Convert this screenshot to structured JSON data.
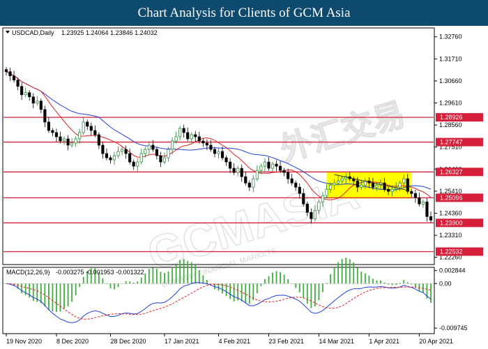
{
  "page_title": "Chart Analysis for Clients of GCM Asia",
  "watermark": {
    "main": "GCMASIA",
    "brand": "外汇交易",
    "sub": "GCMASIA FINANCIAL MARKETS"
  },
  "chart_data": {
    "type": "candlestick",
    "symbol_header": "USDCAD,Daily",
    "ohlc_header": "1.23925 1.24064 1.23846 1.24032",
    "ylim": [
      1.2195,
      1.3315
    ],
    "y_ticks": [
      "1.32760",
      "1.31710",
      "1.30660",
      "1.29610",
      "1.28560",
      "1.27510",
      "1.26460",
      "1.25410",
      "1.24360",
      "1.23310",
      "1.22260"
    ],
    "x_tick_labels": [
      {
        "label": "19 Nov 2020",
        "index": 0
      },
      {
        "label": "8 Dec 2020",
        "index": 13
      },
      {
        "label": "28 Dec 2020",
        "index": 27
      },
      {
        "label": "17 Jan 2021",
        "index": 41
      },
      {
        "label": "4 Feb 2021",
        "index": 55
      },
      {
        "label": "23 Feb 2021",
        "index": 68
      },
      {
        "label": "14 Mar 2021",
        "index": 81
      },
      {
        "label": "1 Apr 2021",
        "index": 94
      },
      {
        "label": "20 Apr 2021",
        "index": 107
      }
    ],
    "levels": [
      {
        "label": "1.28926",
        "value": 1.28926
      },
      {
        "label": "1.27747",
        "value": 1.27747
      },
      {
        "label": "1.26327",
        "value": 1.26327
      },
      {
        "label": "1.25096",
        "value": 1.25096
      },
      {
        "label": "1.23900",
        "value": 1.239
      },
      {
        "label": "1.22532",
        "value": 1.22532
      }
    ],
    "consolidation_box": {
      "start_index": 83,
      "end_index": 105,
      "low": 1.2506,
      "high": 1.2632
    },
    "trend_segment": {
      "start_index": 85,
      "end_index": 104,
      "start_value": 1.262,
      "end_value": 1.2545
    },
    "close": [
      1.311,
      1.309,
      1.307,
      1.304,
      1.3,
      1.301,
      1.299,
      1.296,
      1.297,
      1.293,
      1.287,
      1.283,
      1.282,
      1.28,
      1.278,
      1.279,
      1.276,
      1.277,
      1.279,
      1.282,
      1.287,
      1.285,
      1.283,
      1.281,
      1.276,
      1.272,
      1.27,
      1.269,
      1.271,
      1.273,
      1.274,
      1.272,
      1.268,
      1.266,
      1.268,
      1.272,
      1.274,
      1.276,
      1.274,
      1.271,
      1.268,
      1.27,
      1.274,
      1.278,
      1.28,
      1.284,
      1.282,
      1.279,
      1.281,
      1.28,
      1.278,
      1.277,
      1.276,
      1.274,
      1.272,
      1.273,
      1.27,
      1.268,
      1.265,
      1.263,
      1.265,
      1.261,
      1.258,
      1.256,
      1.26,
      1.264,
      1.266,
      1.268,
      1.265,
      1.267,
      1.266,
      1.264,
      1.263,
      1.26,
      1.258,
      1.256,
      1.253,
      1.248,
      1.244,
      1.241,
      1.245,
      1.249,
      1.252,
      1.255,
      1.257,
      1.258,
      1.259,
      1.26,
      1.261,
      1.26,
      1.259,
      1.256,
      1.257,
      1.259,
      1.258,
      1.256,
      1.257,
      1.258,
      1.255,
      1.254,
      1.255,
      1.256,
      1.258,
      1.26,
      1.254,
      1.253,
      1.251,
      1.248,
      1.249,
      1.242,
      1.2403
    ],
    "indicator": {
      "title": "MACD(12,26,9)",
      "values_header": "-0.003275 -0.001953 -0.001322",
      "ylim": [
        -0.0108,
        0.0034
      ],
      "y_tick_labels": [
        {
          "label": "0.002844",
          "value": 0.002844
        },
        {
          "label": "0.00",
          "value": 0.0
        },
        {
          "label": "-0.009745",
          "value": -0.009745
        }
      ]
    }
  }
}
